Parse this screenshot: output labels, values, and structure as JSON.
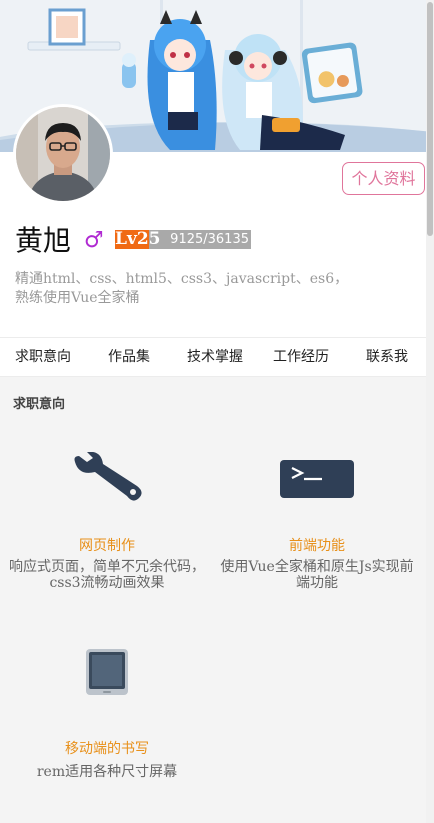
{
  "profile": {
    "name": "黄旭",
    "gender_symbol": "♂",
    "edit_button_label": "个人资料",
    "level_label": "Lv25",
    "level_progress_text": "9125/36135",
    "level_fraction": 0.2525,
    "bio": "精通html、css、html5、css3、javascript、es6，熟练使用Vue全家桶"
  },
  "tabs": [
    {
      "label": "求职意向"
    },
    {
      "label": "作品集"
    },
    {
      "label": "技术掌握"
    },
    {
      "label": "工作经历"
    },
    {
      "label": "联系我"
    }
  ],
  "section": {
    "title": "求职意向"
  },
  "cards": [
    {
      "icon": "wrench-icon",
      "title": "网页制作",
      "description": "响应式页面，简单不冗余代码，css3流畅动画效果"
    },
    {
      "icon": "terminal-icon",
      "title": "前端功能",
      "description": "使用Vue全家桶和原生Js实现前端功能"
    },
    {
      "icon": "tablet-icon",
      "title": "移动端的书写",
      "description": "rem适用各种尺寸屏幕"
    }
  ],
  "colors": {
    "accent_pink": "#e0759b",
    "level_orange": "#f06a14",
    "gender_purple": "#b02ad2",
    "card_title_orange": "#e8901a",
    "icon_navy": "#2f3f56"
  }
}
